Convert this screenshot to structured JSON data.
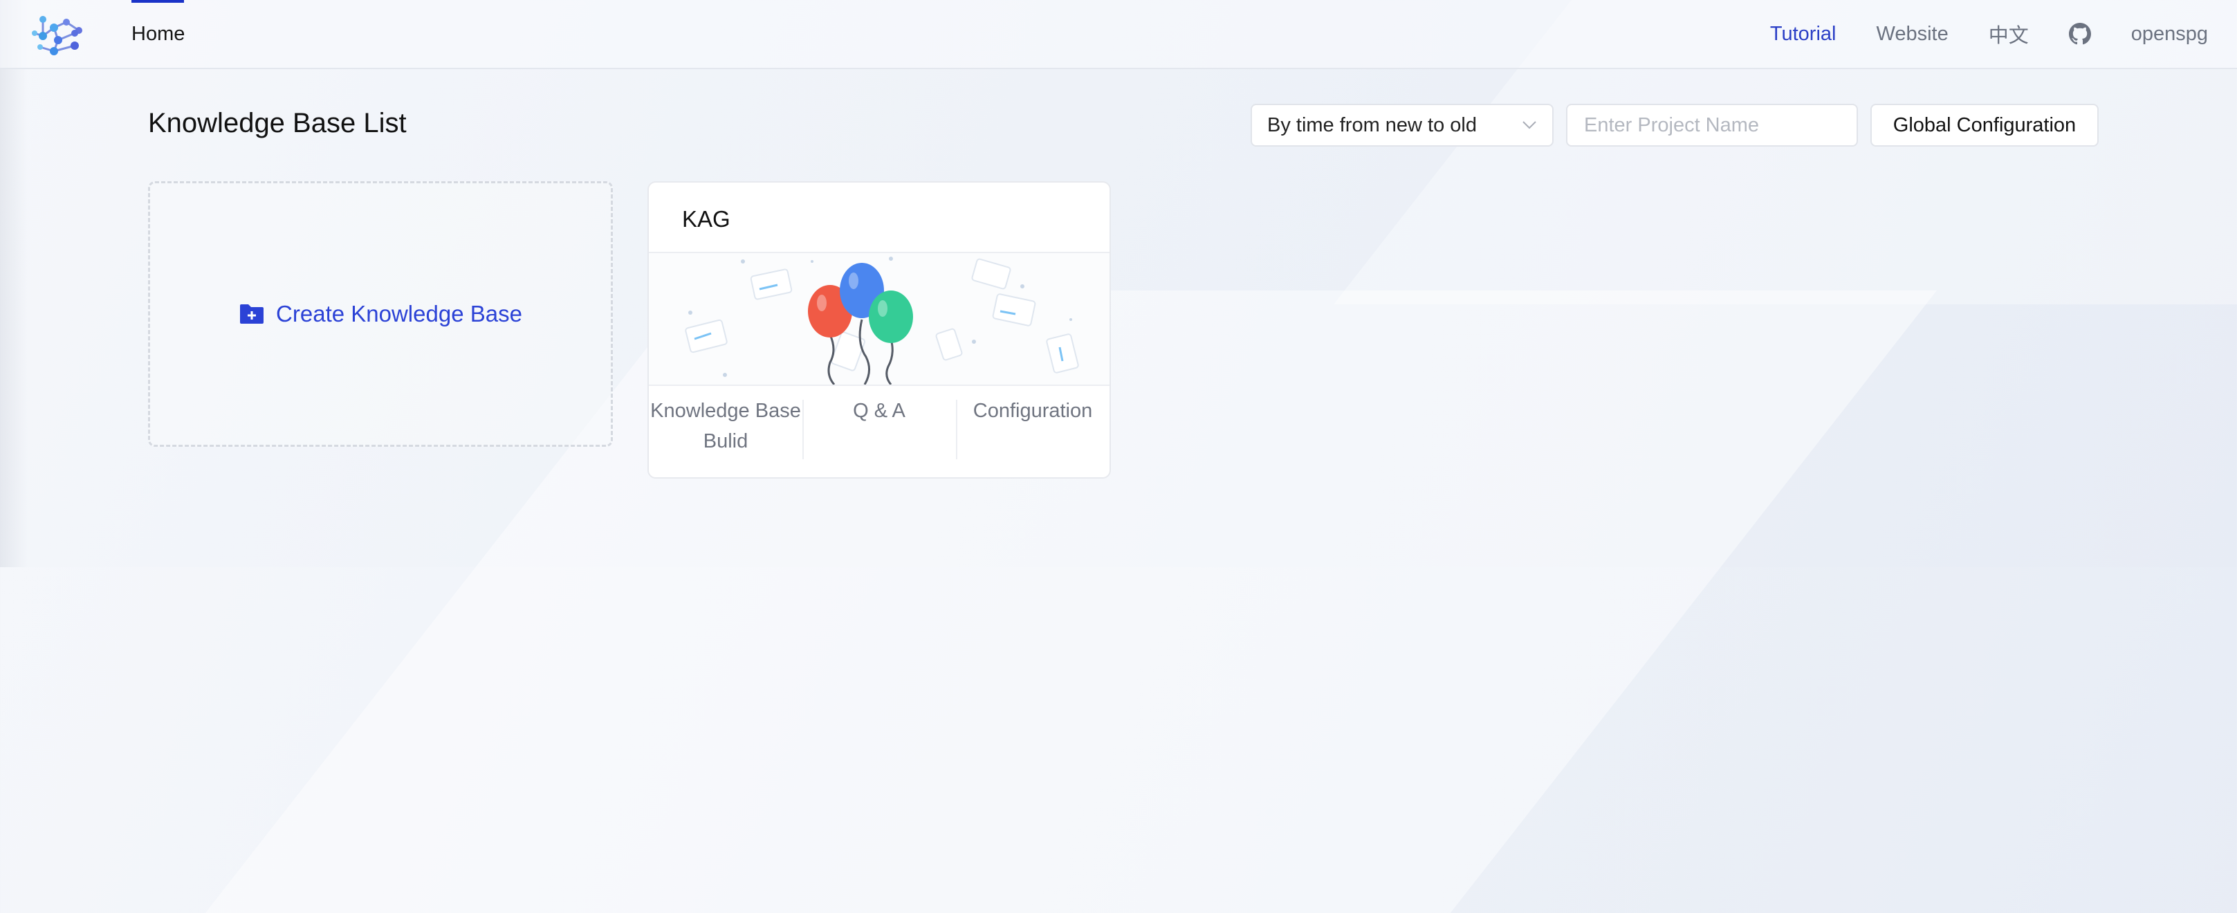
{
  "header": {
    "nav_home": "Home",
    "links": {
      "tutorial": "Tutorial",
      "website": "Website",
      "language": "中文",
      "user": "openspg"
    },
    "active_color": "#2b3fc6"
  },
  "main": {
    "title": "Knowledge Base List",
    "sort_select": {
      "value": "By time from new to old"
    },
    "search": {
      "placeholder": "Enter Project Name",
      "value": ""
    },
    "global_config_label": "Global Configuration",
    "create_label": "Create Knowledge Base",
    "projects": [
      {
        "name": "KAG",
        "actions": [
          "Knowledge Base Bulid",
          "Q & A",
          "Configuration"
        ]
      }
    ]
  },
  "icons": [
    "openspg-logo-icon",
    "github-icon",
    "chevron-down-icon",
    "search-icon",
    "folder-plus-icon",
    "balloons-illustration"
  ],
  "colors": {
    "primary": "#2b42d6",
    "balloon_red": "#f05a45",
    "balloon_blue": "#4b86ef",
    "balloon_green": "#35cc96"
  }
}
